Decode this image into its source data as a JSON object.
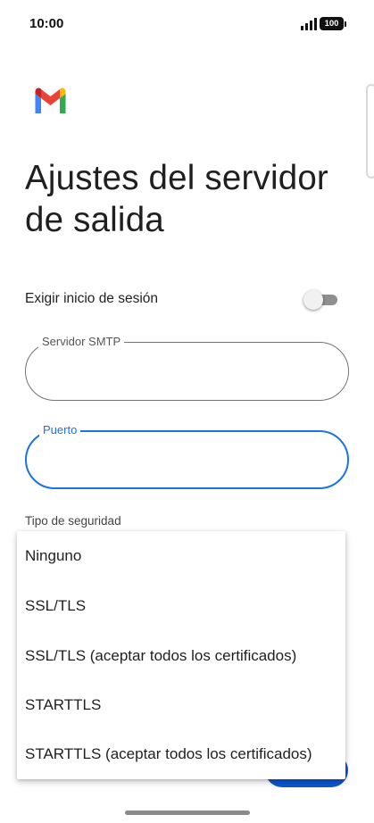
{
  "status_bar": {
    "time": "10:00",
    "battery": "100"
  },
  "title": "Ajustes del servidor de salida",
  "login_toggle": {
    "label": "Exigir inicio de sesión",
    "enabled": false
  },
  "smtp_field": {
    "label": "Servidor SMTP",
    "value": ""
  },
  "port_field": {
    "label": "Puerto",
    "value": ""
  },
  "security": {
    "label": "Tipo de seguridad",
    "options": [
      "Ninguno",
      "SSL/TLS",
      "SSL/TLS (aceptar todos los certificados)",
      "STARTTLS",
      "STARTTLS (aceptar todos los certificados)"
    ]
  },
  "icons": {
    "logo": "gmail-icon",
    "signal": "signal-icon",
    "battery": "battery-icon"
  },
  "colors": {
    "accent": "#1a73e8",
    "button": "#0b57d0",
    "gmail_red": "#ea4335",
    "gmail_blue": "#4285f4",
    "gmail_green": "#34a853",
    "gmail_yellow": "#fbbc04"
  }
}
